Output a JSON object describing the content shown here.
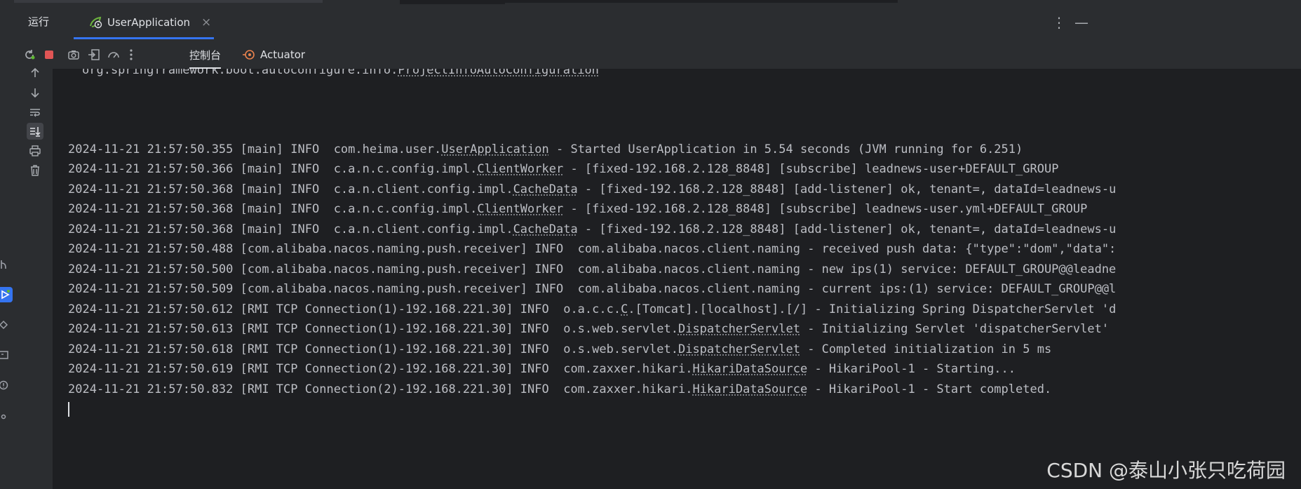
{
  "header": {
    "run_label": "运行",
    "app_tab_label": "UserApplication",
    "close_glyph": "×",
    "more_glyph": "⋮",
    "minimize_glyph": "—"
  },
  "subtabs": {
    "console_label": "控制台",
    "actuator_label": "Actuator"
  },
  "console": {
    "first_line": {
      "pre": "org.springframework.boot.autoconfigure.info.",
      "cls": "ProjectInfoAutoConfiguration",
      "post": ""
    },
    "lines": [
      {
        "pre": "2024-11-21 21:57:50.355 [main] INFO  com.heima.user.",
        "cls": "UserApplication",
        "post": " - Started UserApplication in 5.54 seconds (JVM running for 6.251)"
      },
      {
        "pre": "2024-11-21 21:57:50.366 [main] INFO  c.a.n.c.config.impl.",
        "cls": "ClientWorker",
        "post": " - [fixed-192.168.2.128_8848] [subscribe] leadnews-user+DEFAULT_GROUP"
      },
      {
        "pre": "2024-11-21 21:57:50.368 [main] INFO  c.a.n.client.config.impl.",
        "cls": "CacheData",
        "post": " - [fixed-192.168.2.128_8848] [add-listener] ok, tenant=, dataId=leadnews-u"
      },
      {
        "pre": "2024-11-21 21:57:50.368 [main] INFO  c.a.n.c.config.impl.",
        "cls": "ClientWorker",
        "post": " - [fixed-192.168.2.128_8848] [subscribe] leadnews-user.yml+DEFAULT_GROUP"
      },
      {
        "pre": "2024-11-21 21:57:50.368 [main] INFO  c.a.n.client.config.impl.",
        "cls": "CacheData",
        "post": " - [fixed-192.168.2.128_8848] [add-listener] ok, tenant=, dataId=leadnews-u"
      },
      {
        "pre": "2024-11-21 21:57:50.488 [com.alibaba.nacos.naming.push.receiver] INFO  com.alibaba.nacos.client.naming - received push data: {\"type\":\"dom\",\"data\":",
        "cls": "",
        "post": ""
      },
      {
        "pre": "2024-11-21 21:57:50.500 [com.alibaba.nacos.naming.push.receiver] INFO  com.alibaba.nacos.client.naming - new ips(1) service: DEFAULT_GROUP@@leadne",
        "cls": "",
        "post": ""
      },
      {
        "pre": "2024-11-21 21:57:50.509 [com.alibaba.nacos.naming.push.receiver] INFO  com.alibaba.nacos.client.naming - current ips:(1) service: DEFAULT_GROUP@@l",
        "cls": "",
        "post": ""
      },
      {
        "pre": "2024-11-21 21:57:50.612 [RMI TCP Connection(1)-192.168.221.30] INFO  o.a.c.c.",
        "cls": "C",
        "post": ".[Tomcat].[localhost].[/] - Initializing Spring DispatcherServlet 'd"
      },
      {
        "pre": "2024-11-21 21:57:50.613 [RMI TCP Connection(1)-192.168.221.30] INFO  o.s.web.servlet.",
        "cls": "DispatcherServlet",
        "post": " - Initializing Servlet 'dispatcherServlet'"
      },
      {
        "pre": "2024-11-21 21:57:50.618 [RMI TCP Connection(1)-192.168.221.30] INFO  o.s.web.servlet.",
        "cls": "DispatcherServlet",
        "post": " - Completed initialization in 5 ms"
      },
      {
        "pre": "2024-11-21 21:57:50.619 [RMI TCP Connection(2)-192.168.221.30] INFO  com.zaxxer.hikari.",
        "cls": "HikariDataSource",
        "post": " - HikariPool-1 - Starting..."
      },
      {
        "pre": "2024-11-21 21:57:50.832 [RMI TCP Connection(2)-192.168.221.30] INFO  com.zaxxer.hikari.",
        "cls": "HikariDataSource",
        "post": " - HikariPool-1 - Start completed."
      }
    ]
  },
  "watermark": "CSDN @泰山小张只吃荷园",
  "icons": {
    "app": "spring-run-icon",
    "rerun": "rerun-icon",
    "stop": "stop-icon",
    "camera": "camera-icon",
    "exit": "exit-icon",
    "gauge": "gauge-icon",
    "actuator": "actuator-icon"
  },
  "colors": {
    "accent": "#3574f0",
    "stop": "#e05555",
    "spring_green": "#6db33f",
    "actuator_orange": "#e8824d"
  }
}
